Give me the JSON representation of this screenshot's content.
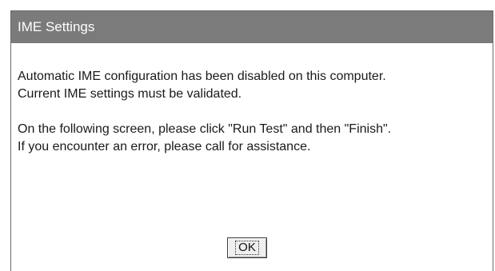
{
  "window": {
    "title": "IME Settings"
  },
  "message": {
    "paragraph1": {
      "line1": "Automatic IME configuration has been disabled on this computer.",
      "line2": "Current IME settings must be validated."
    },
    "paragraph2": {
      "line1": "On the following screen, please click \"Run Test\" and then \"Finish\".",
      "line2": "If you encounter an error, please call for assistance."
    }
  },
  "buttons": {
    "ok_label": "OK"
  },
  "colors": {
    "titlebar": "#7b7b7b",
    "title_text": "#ffffff",
    "background": "#ffffff",
    "body_text": "#1a1a1a"
  }
}
